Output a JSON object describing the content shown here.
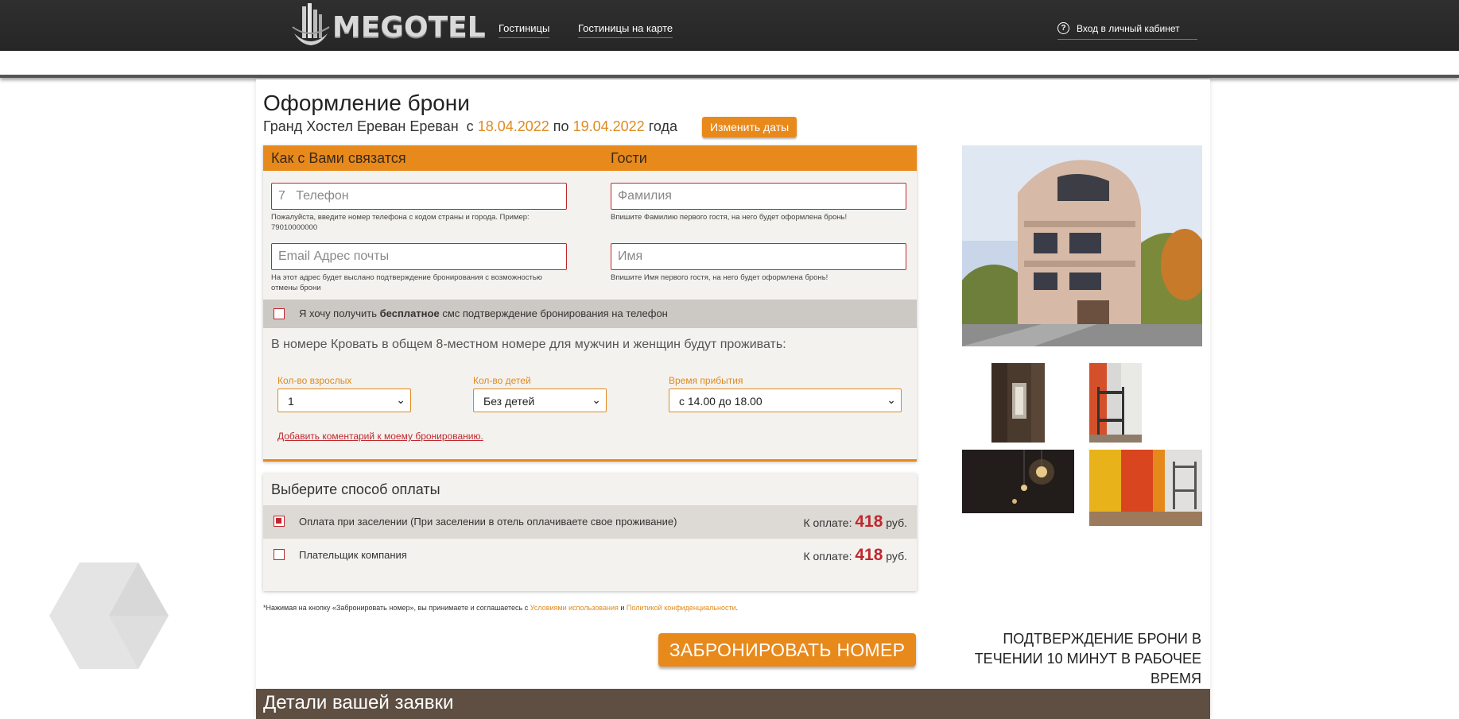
{
  "header": {
    "logo_text": "MEGOTEL",
    "nav": [
      "Гостиницы",
      "Гостиницы на карте"
    ],
    "login_label": "Вход в личный кабинет",
    "login_icon": "question-circle-icon"
  },
  "booking": {
    "title": "Оформление брони",
    "hotel": "Гранд Хостел Ереван Ереван",
    "from_prefix": "с",
    "date_from": "18.04.2022",
    "to_prefix": "по",
    "date_to": "19.04.2022",
    "suffix": "года",
    "change_dates_label": "Изменить даты"
  },
  "form": {
    "contact_heading": "Как с Вами связатся",
    "guests_heading": "Гости",
    "phone_prefix": "7",
    "phone_placeholder": "Телефон",
    "phone_hint": "Пожалуйста, введите номер телефона с кодом страны и города. Пример: 79010000000",
    "email_placeholder": "Email Адрес почты",
    "email_hint": "На этот адрес будет выслано подтверждение бронирования с возможностью отмены брони",
    "surname_placeholder": "Фамилия",
    "surname_hint": "Впишите Фамилию первого гостя, на него будет оформлена бронь!",
    "name_placeholder": "Имя",
    "name_hint": "Впишите Имя первого гостя, на него будет оформлена бронь!",
    "sms_before": "Я хочу получить",
    "sms_bold": "бесплатное",
    "sms_after": "смс подтверждение бронирования на телефон",
    "room_text": "В номере Кровать в общем 8-местном номере для мужчин и женщин будут проживать:",
    "adults_label": "Кол-во взрослых",
    "adults_value": "1",
    "children_label": "Кол-во детей",
    "children_value": "Без детей",
    "arrival_label": "Время прибытия",
    "arrival_value": "с 14.00 до 18.00",
    "comment_link": "Добавить коментарий к моему бронированию."
  },
  "payment": {
    "title": "Выберите способ оплаты",
    "options": [
      {
        "label": "Оплата при заселении (При заселении в отель оплачиваете свое проживание)",
        "amount_label": "К оплате:",
        "amount": "418",
        "currency": "руб.",
        "checked": true
      },
      {
        "label": "Плательщик компания",
        "amount_label": "К оплате:",
        "amount": "418",
        "currency": "руб.",
        "checked": false
      }
    ]
  },
  "footer": {
    "agree_before": "*Нажимая на кнопку «Забронировать номер», вы принимаете и соглашаетесь с",
    "terms_link": "Условиями использования",
    "and": "и",
    "privacy_link": "Политикой конфиденциальности",
    "agree_end": ".",
    "book_button": "ЗАБРОНИРОВАТЬ НОМЕР",
    "confirm_note": "ПОДТВЕРЖДЕНИЕ БРОНИ В ТЕЧЕНИИ 10 МИНУТ В РАБОЧЕЕ ВРЕМЯ",
    "details_heading": "Детали вашей заявки"
  },
  "colors": {
    "accent": "#e8891c",
    "error_red": "#c0272d",
    "topbar": "#2b2b2b",
    "details_bar": "#5e4f42"
  }
}
